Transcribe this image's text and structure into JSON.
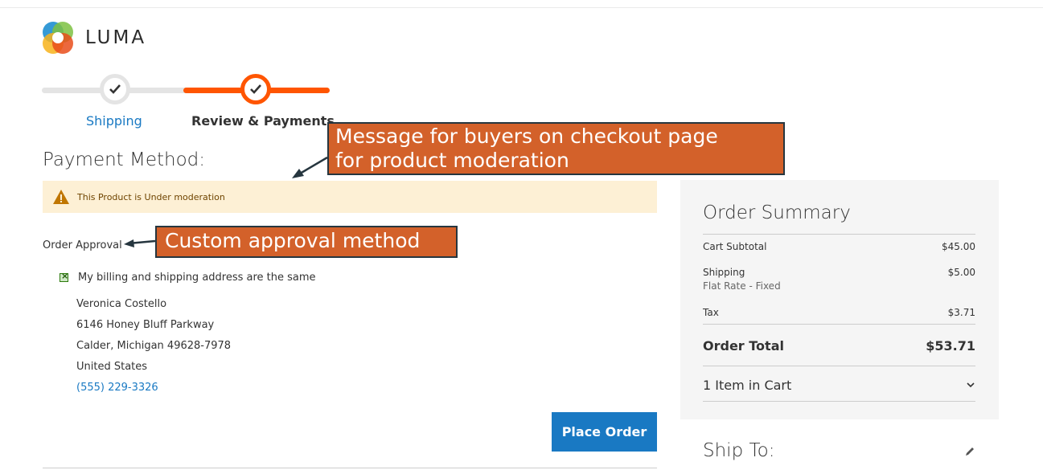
{
  "brand": {
    "name": "LUMA"
  },
  "progress": {
    "steps": [
      {
        "label": "Shipping",
        "state": "complete"
      },
      {
        "label": "Review & Payments",
        "state": "active"
      }
    ]
  },
  "payment": {
    "title": "Payment Method:",
    "notice": "This Product is Under moderation",
    "method_label": "Order Approval",
    "billing_same_label": "My billing and shipping address are the same",
    "address": {
      "name": "Veronica Costello",
      "street": "6146 Honey Bluff Parkway",
      "city_line": "Calder, Michigan 49628-7978",
      "country": "United States",
      "phone": "(555) 229-3326"
    },
    "place_order_label": "Place Order"
  },
  "summary": {
    "title": "Order Summary",
    "subtotal_label": "Cart Subtotal",
    "subtotal_value": "$45.00",
    "shipping_label": "Shipping",
    "shipping_method": "Flat Rate - Fixed",
    "shipping_value": "$5.00",
    "tax_label": "Tax",
    "tax_value": "$3.71",
    "total_label": "Order Total",
    "total_value": "$53.71",
    "items_label": "1 Item in Cart"
  },
  "ship_to": {
    "title": "Ship To:"
  },
  "annotations": {
    "callout_1_line_1": "Message for buyers on checkout page",
    "callout_1_line_2": "for product moderation",
    "callout_2": "Custom approval method"
  },
  "colors": {
    "accent_orange": "#ff5501",
    "link_blue": "#1979c3",
    "callout_fill": "#d3612a",
    "notice_bg": "#fdf0d5"
  }
}
